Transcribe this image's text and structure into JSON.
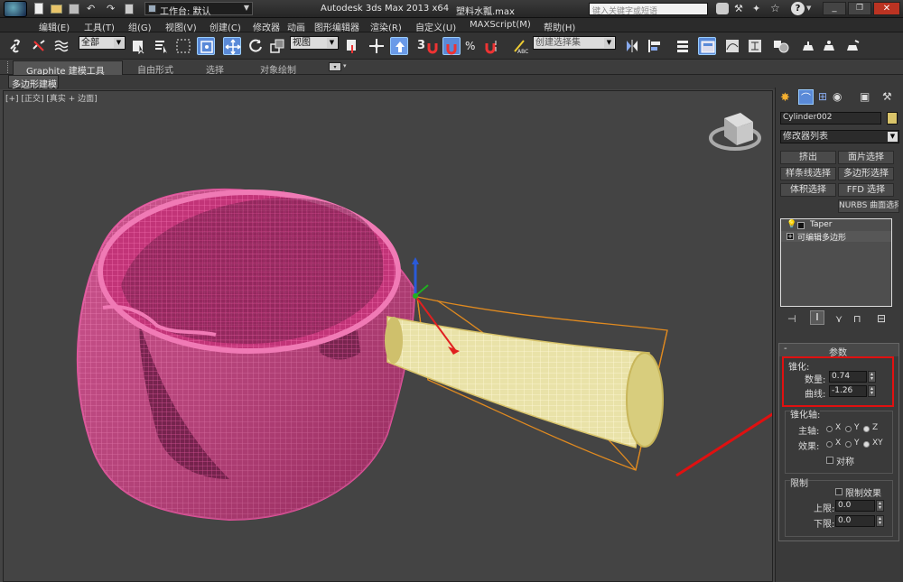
{
  "titlebar": {
    "workspace_label": "工作台: 默认",
    "app_title": "Autodesk 3ds Max  2013 x64",
    "file_name": "塑料水瓢.max",
    "search_placeholder": "键入关键字或短语"
  },
  "menu": [
    "编辑(E)",
    "工具(T)",
    "组(G)",
    "视图(V)",
    "创建(C)",
    "修改器",
    "动画",
    "图形编辑器",
    "渲染(R)",
    "自定义(U)",
    "MAXScript(M)",
    "帮助(H)"
  ],
  "toolbar": {
    "selection_filter": "全部",
    "reference_coord": "视图",
    "snap_label": "3",
    "named_selection": "创建选择集"
  },
  "ribbon": {
    "tabs": [
      "Graphite 建模工具",
      "自由形式",
      "选择",
      "对象绘制"
    ],
    "subtab": "多边形建模"
  },
  "viewport": {
    "label_plus": "[+]",
    "label_view": "[正交]",
    "label_shading": "[真实 + 边面]"
  },
  "cmdpanel": {
    "object_name": "Cylinder002",
    "object_color": "#d9c46a",
    "modifier_list": "修改器列表",
    "modifier_buttons": [
      "挤出",
      "面片选择",
      "样条线选择",
      "多边形选择",
      "体积选择",
      "FFD 选择",
      "NURBS 曲面选择"
    ],
    "stack": [
      {
        "label": "Taper"
      },
      {
        "label": "可编辑多边形"
      }
    ],
    "rollout_title": "参数",
    "taper_group": "锥化:",
    "amount_label": "数量:",
    "amount_value": "0.74",
    "curve_label": "曲线:",
    "curve_value": "-1.26",
    "axis_group": "锥化轴:",
    "primary_label": "主轴:",
    "primary_options": [
      "X",
      "Y",
      "Z"
    ],
    "primary_selected": "Z",
    "effect_label": "效果:",
    "effect_options": [
      "X",
      "Y",
      "XY"
    ],
    "effect_selected": "XY",
    "symmetry_label": "对称",
    "limit_group": "限制",
    "limit_effect_label": "限制效果",
    "upper_label": "上限:",
    "upper_value": "0.0",
    "lower_label": "下限:",
    "lower_value": "0.0"
  },
  "colors": {
    "highlight_red": "#e01010",
    "model_pink": "#d63a85",
    "handle_yellow": "#e8dfa0"
  }
}
